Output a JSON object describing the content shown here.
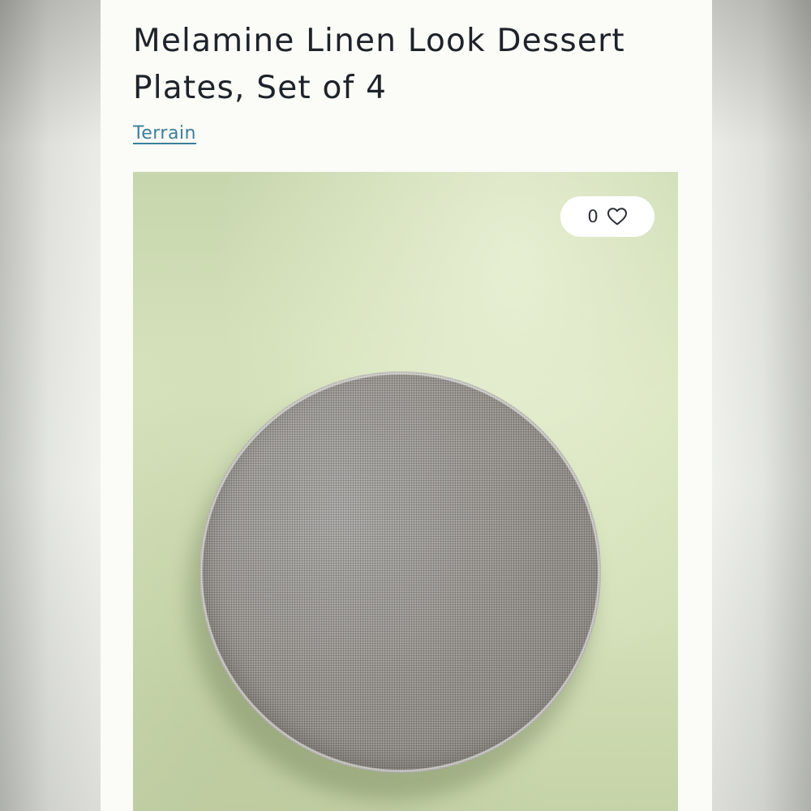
{
  "product": {
    "title": "Melamine Linen Look Dessert Plates, Set of 4",
    "brand": "Terrain"
  },
  "favorite": {
    "count": "0",
    "icon": "heart-outline-icon"
  },
  "colors": {
    "brand_link": "#3a7f9a",
    "title_text": "#1e232a",
    "card_background": "#fbfbf7",
    "image_background": "#d3e0b8"
  }
}
